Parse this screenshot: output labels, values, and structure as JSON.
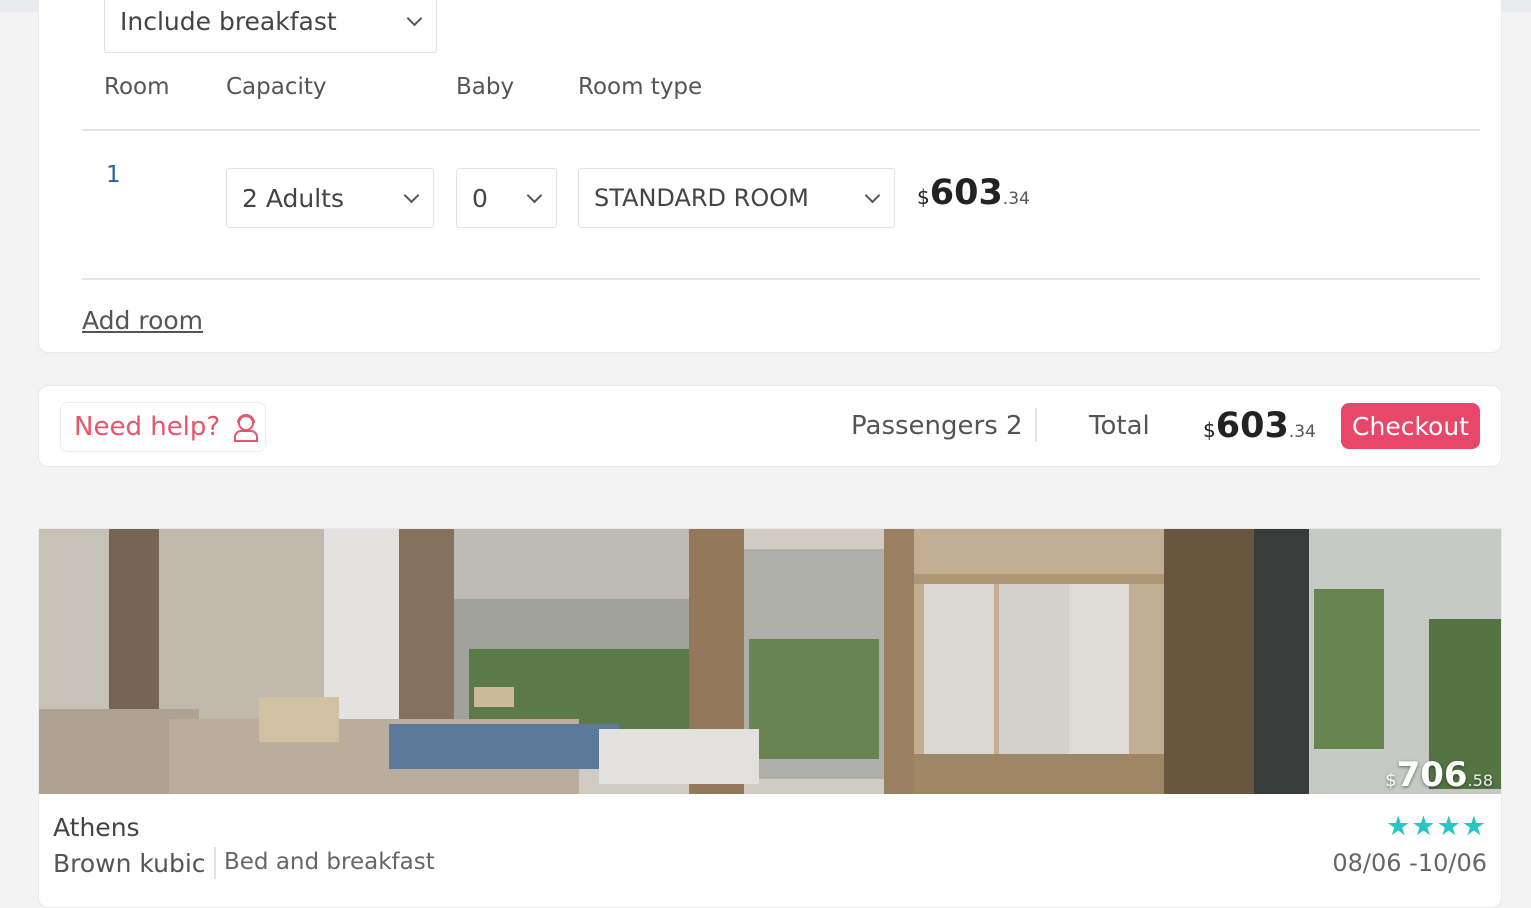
{
  "room_config": {
    "board_select": "Include breakfast",
    "columns": [
      "Room",
      "Capacity",
      "Baby",
      "Room type"
    ],
    "rows": [
      {
        "room": "1",
        "capacity": "2 Adults",
        "baby": "0",
        "room_type": "STANDARD ROOM",
        "price": {
          "currency": "$",
          "integer": "603",
          "decimals": ".34"
        }
      }
    ],
    "add_room_label": "Add room"
  },
  "summary": {
    "help_label": "Need help?",
    "passengers_label": "Passengers 2",
    "total_label": "Total",
    "total_price": {
      "currency": "$",
      "integer": "603",
      "decimals": ".34"
    },
    "checkout_label": "Checkout"
  },
  "hotel": {
    "photo_price": {
      "currency": "$",
      "integer": "706",
      "decimals": ".58"
    },
    "city": "Athens",
    "name": "Brown kubic",
    "board": "Bed and breakfast",
    "stars": "★★★★",
    "dates": "08/06 -10/06"
  },
  "colors": {
    "accent": "#e8476a",
    "help_text": "#e5566c",
    "stars": "#26c6c6",
    "room_number": "#2b5ea7"
  }
}
